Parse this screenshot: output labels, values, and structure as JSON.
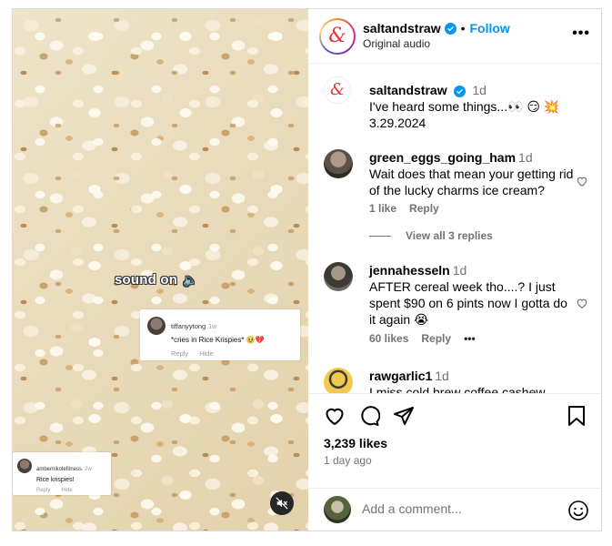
{
  "media": {
    "overlay_text": "sound on",
    "overlay_emoji": "🔈",
    "cards": [
      {
        "user": "tiffanyytong",
        "time": "1w",
        "text": "*cries in Rice Krispies* 🥹💔",
        "reply": "Reply",
        "hide": "Hide"
      },
      {
        "user": "ambernikolefitness",
        "time": "2w",
        "text": "Rice krispies!",
        "reply": "Reply",
        "hide": "Hide"
      }
    ],
    "mute_icon": "speaker-muted-icon"
  },
  "header": {
    "username": "saltandstraw",
    "separator": "•",
    "follow_label": "Follow",
    "subtitle": "Original audio",
    "more_label": "•••",
    "logo_glyph": "&"
  },
  "caption": {
    "username": "saltandstraw",
    "time": "1d",
    "line1": "I've heard some things...👀 😏 💥",
    "line2": "3.29.2024"
  },
  "comments": [
    {
      "username": "green_eggs_going_ham",
      "time": "1d",
      "text": "Wait does that mean your getting rid of the lucky charms ice cream?",
      "likes": "1 like",
      "reply": "Reply",
      "view_replies": "View all 3 replies"
    },
    {
      "username": "jennahesseln",
      "time": "1d",
      "text": "AFTER cereal week tho....? I just spent $90 on 6 pints now I gotta do it again 😭",
      "likes": "60 likes",
      "reply": "Reply",
      "more": "•••"
    },
    {
      "username": "rawgarlic1",
      "time": "1d",
      "text": "I miss cold brew coffee cashew"
    }
  ],
  "post_stats": {
    "likes": "3,239 likes",
    "date": "1 day ago"
  },
  "add_comment": {
    "placeholder": "Add a comment..."
  },
  "colors": {
    "accent": "#0095f6",
    "secondary_text": "#737373",
    "border": "#dbdbdb",
    "brand_logo": "#e2343a"
  }
}
